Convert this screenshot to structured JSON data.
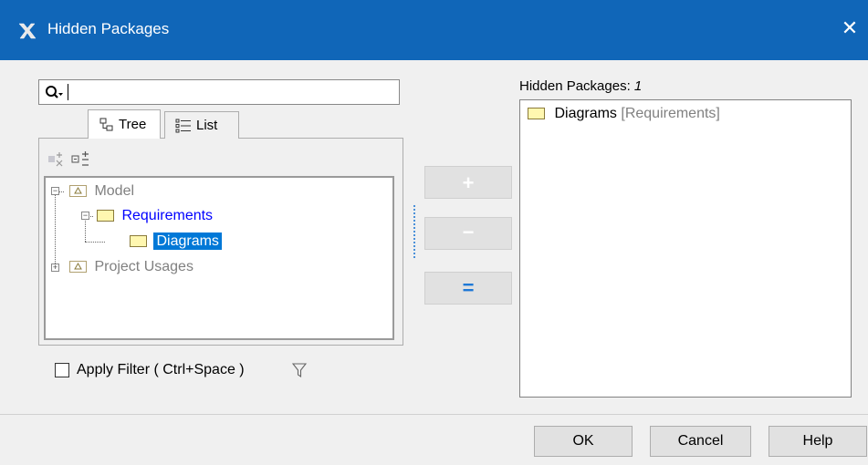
{
  "window": {
    "title": "Hidden Packages",
    "close_glyph": "✕"
  },
  "search": {
    "value": "",
    "icon": "search-icon"
  },
  "tabs": [
    {
      "label": "Tree",
      "icon": "tree-view-icon"
    },
    {
      "label": "List",
      "icon": "list-view-icon"
    }
  ],
  "tree": {
    "model_label": "Model",
    "requirements_label": "Requirements",
    "diagrams_label": "Diagrams",
    "project_usages_label": "Project Usages"
  },
  "filter": {
    "label": "Apply Filter ( Ctrl+Space )",
    "checked": false
  },
  "buttons": {
    "add": "+",
    "remove": "−",
    "remove_all": "="
  },
  "hidden": {
    "header": "Hidden Packages: ",
    "count": "1",
    "items": [
      {
        "name": "Diagrams",
        "owner": "[Requirements]"
      }
    ]
  },
  "footer": {
    "ok": "OK",
    "cancel": "Cancel",
    "help": "Help"
  },
  "colors": {
    "titlebar": "#1066b8",
    "selection": "#0078d7",
    "link_blue": "#0000ff",
    "muted": "#808080"
  }
}
